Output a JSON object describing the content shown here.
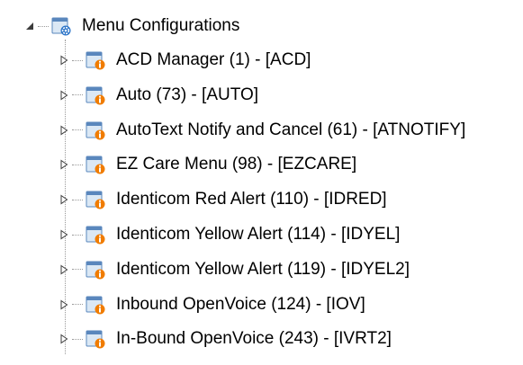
{
  "tree": {
    "root": {
      "label": "Menu Configurations",
      "expanded": true,
      "icon": "folder-gear-icon"
    },
    "items": [
      {
        "label": "ACD Manager (1) - [ACD]",
        "icon": "folder-info-icon"
      },
      {
        "label": "Auto (73) - [AUTO]",
        "icon": "folder-info-icon"
      },
      {
        "label": "AutoText Notify and Cancel (61) - [ATNOTIFY]",
        "icon": "folder-info-icon"
      },
      {
        "label": "EZ Care Menu (98) - [EZCARE]",
        "icon": "folder-info-icon"
      },
      {
        "label": "Identicom Red Alert (110) - [IDRED]",
        "icon": "folder-info-icon"
      },
      {
        "label": "Identicom Yellow Alert (114) - [IDYEL]",
        "icon": "folder-info-icon"
      },
      {
        "label": "Identicom Yellow Alert (119) - [IDYEL2]",
        "icon": "folder-info-icon"
      },
      {
        "label": "Inbound OpenVoice (124) - [IOV]",
        "icon": "folder-info-icon"
      },
      {
        "label": "In-Bound OpenVoice (243) - [IVRT2]",
        "icon": "folder-info-icon"
      }
    ]
  },
  "colors": {
    "folder_light": "#dbe8f5",
    "folder_dark": "#5a87bd",
    "badge_orange": "#f07c00",
    "badge_blue": "#2b74c8"
  }
}
